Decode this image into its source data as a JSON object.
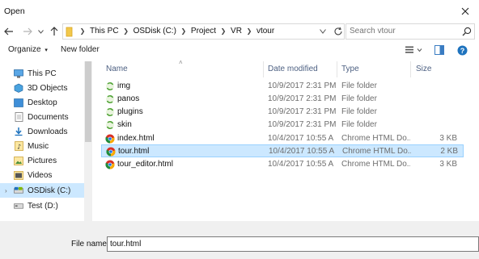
{
  "window": {
    "title": "Open"
  },
  "address": {
    "crumbs": [
      "This PC",
      "OSDisk (C:)",
      "Project",
      "VR",
      "vtour"
    ],
    "search_placeholder": "Search vtour"
  },
  "toolbar": {
    "organize_label": "Organize",
    "new_folder_label": "New folder"
  },
  "nav": {
    "items": [
      {
        "label": "This PC",
        "icon": "pc-icon"
      },
      {
        "label": "3D Objects",
        "icon": "3d-objects-icon"
      },
      {
        "label": "Desktop",
        "icon": "desktop-icon"
      },
      {
        "label": "Documents",
        "icon": "documents-icon"
      },
      {
        "label": "Downloads",
        "icon": "downloads-icon"
      },
      {
        "label": "Music",
        "icon": "music-icon"
      },
      {
        "label": "Pictures",
        "icon": "pictures-icon"
      },
      {
        "label": "Videos",
        "icon": "videos-icon"
      },
      {
        "label": "OSDisk (C:)",
        "icon": "drive-icon",
        "selected": true
      },
      {
        "label": "Test (D:)",
        "icon": "drive-icon"
      }
    ]
  },
  "columns": {
    "name": "Name",
    "date": "Date modified",
    "type": "Type",
    "size": "Size"
  },
  "files": [
    {
      "name": "img",
      "date": "10/9/2017 2:31 PM",
      "type": "File folder",
      "size": "",
      "icon": "folder-sync-icon"
    },
    {
      "name": "panos",
      "date": "10/9/2017 2:31 PM",
      "type": "File folder",
      "size": "",
      "icon": "folder-sync-icon"
    },
    {
      "name": "plugins",
      "date": "10/9/2017 2:31 PM",
      "type": "File folder",
      "size": "",
      "icon": "folder-sync-icon"
    },
    {
      "name": "skin",
      "date": "10/9/2017 2:31 PM",
      "type": "File folder",
      "size": "",
      "icon": "folder-sync-icon"
    },
    {
      "name": "index.html",
      "date": "10/4/2017 10:55 A",
      "type": "Chrome HTML Do...",
      "size": "3 KB",
      "icon": "chrome-html-icon"
    },
    {
      "name": "tour.html",
      "date": "10/4/2017 10:55 A",
      "type": "Chrome HTML Do...",
      "size": "2 KB",
      "icon": "chrome-html-icon",
      "selected": true
    },
    {
      "name": "tour_editor.html",
      "date": "10/4/2017 10:55 A",
      "type": "Chrome HTML Do...",
      "size": "3 KB",
      "icon": "chrome-html-icon"
    }
  ],
  "footer": {
    "filename_label": "File name:",
    "filename_value": "tour.html"
  },
  "colors": {
    "selection": "#cce8ff",
    "selection_border": "#99d1ff",
    "header_text": "#4d6082",
    "accent": "#1e73be"
  }
}
